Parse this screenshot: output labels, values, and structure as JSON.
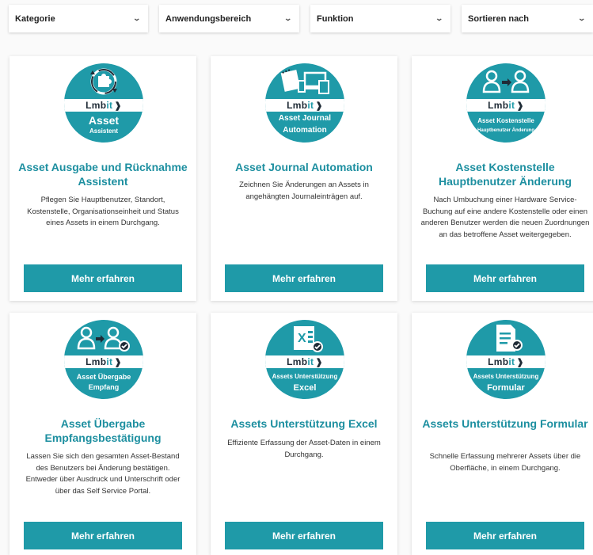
{
  "filters": [
    {
      "label": "Kategorie"
    },
    {
      "label": "Anwendungsbereich"
    },
    {
      "label": "Funktion"
    },
    {
      "label": "Sortieren nach"
    }
  ],
  "brand": {
    "prefix": "Lmb",
    "accent": "it",
    "color": "#1f9aa8"
  },
  "cards": [
    {
      "badge_line1": "Asset",
      "badge_line2": "Assistent",
      "icon": "puzzle-refresh-icon",
      "title": "Asset Ausgabe und Rücknahme Assistent",
      "description": "Pflegen Sie Hauptbenutzer, Standort, Kostenstelle, Organisationseinheit und Status eines Assets in einem Durchgang.",
      "button": "Mehr erfahren"
    },
    {
      "badge_line1": "Asset Journal",
      "badge_line2": "Automation",
      "icon": "devices-notebook-icon",
      "title": "Asset Journal Automation",
      "description": "Zeichnen Sie Änderungen an Assets in angehängten Journaleinträgen auf.",
      "button": "Mehr erfahren"
    },
    {
      "badge_line1": "Asset Kostenstelle",
      "badge_line2": "Hauptbenutzer Änderung",
      "icon": "users-transfer-icon",
      "title": "Asset Kostenstelle Hauptbenutzer Änderung",
      "description": "Nach Umbuchung einer Hardware Service-Buchung auf eine andere Kostenstelle oder einen anderen Benutzer werden die neuen Zuordnungen an das betroffene Asset weitergegeben.",
      "button": "Mehr erfahren"
    },
    {
      "badge_line1": "Asset Übergabe",
      "badge_line2": "Empfang",
      "icon": "users-handover-check-icon",
      "title": "Asset Übergabe Empfangsbestätigung",
      "description": "Lassen Sie sich den gesamten Asset-Bestand des Benutzers bei Änderung bestätigen. Entweder über Ausdruck und Unterschrift oder über das Self Service Portal.",
      "button": "Mehr erfahren"
    },
    {
      "badge_line1": "Assets Unterstützung",
      "badge_line2": "Excel",
      "icon": "excel-check-icon",
      "title": "Assets Unterstützung Excel",
      "description": "Effiziente Erfassung der Asset-Daten in einem Durchgang.",
      "button": "Mehr erfahren"
    },
    {
      "badge_line1": "Assets Unterstützung",
      "badge_line2": "Formular",
      "icon": "form-check-icon",
      "title": "Assets Unterstützung Formular",
      "description": "Schnelle Erfassung mehrerer Assets über die Oberfläche, in einem Durchgang.",
      "button": "Mehr erfahren"
    }
  ]
}
